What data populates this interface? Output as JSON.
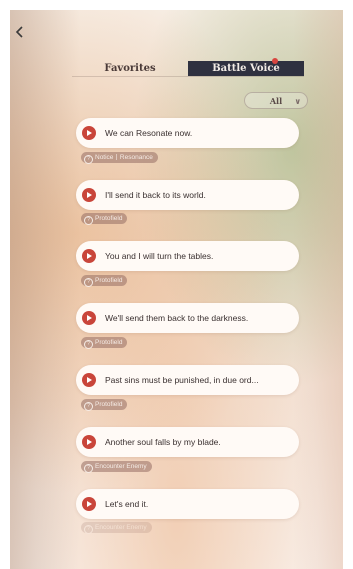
{
  "tabs": [
    {
      "label": "Favorites",
      "active": false
    },
    {
      "label": "Battle Voice",
      "active": true
    }
  ],
  "filter": {
    "label": "All"
  },
  "voices": [
    {
      "line": "We can Resonate now.",
      "tag": "Notice丨Resonance"
    },
    {
      "line": "I'll send it back to its world.",
      "tag": "Protofield"
    },
    {
      "line": "You and I will turn the tables.",
      "tag": "Protofield"
    },
    {
      "line": "We'll send them back to the darkness.",
      "tag": "Protofield"
    },
    {
      "line": "Past sins must be punished, in due ord...",
      "tag": "Protofield"
    },
    {
      "line": "Another soul falls by my blade.",
      "tag": "Encounter Enemy"
    },
    {
      "line": "Let's end it.",
      "tag": "Encounter Enemy"
    }
  ],
  "colors": {
    "accent": "#c9453a",
    "tab_active_bg": "#2f3140",
    "notification_dot": "#d8453f"
  }
}
